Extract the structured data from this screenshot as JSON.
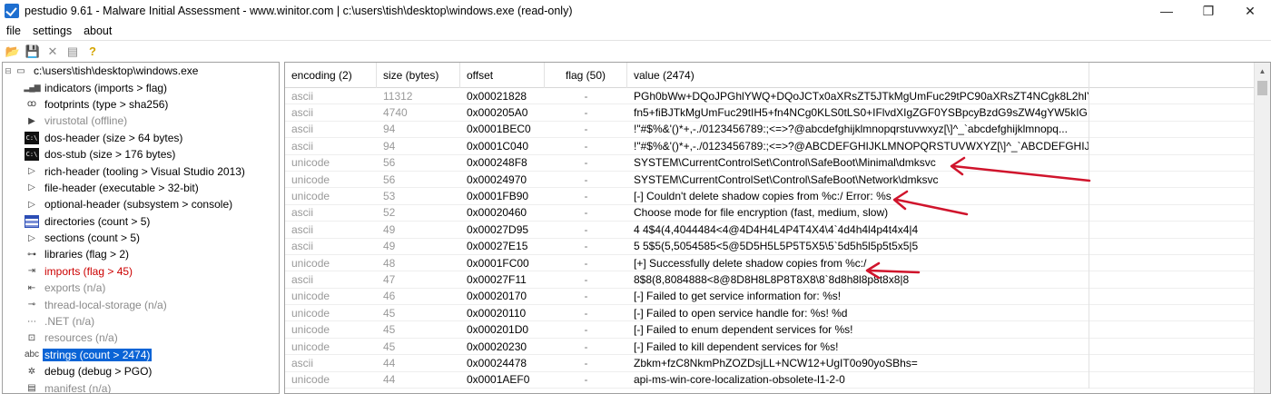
{
  "window": {
    "title": "pestudio 9.61 - Malware Initial Assessment - www.winitor.com | c:\\users\\tish\\desktop\\windows.exe (read-only)",
    "controls": {
      "minimize": "—",
      "maximize": "❐",
      "close": "✕"
    }
  },
  "menu": [
    "file",
    "settings",
    "about"
  ],
  "toolbar": {
    "icons": [
      "open-icon",
      "save-icon",
      "close-file-icon",
      "copy-icon",
      "help-icon"
    ],
    "glyphs": [
      "📂",
      "💾",
      "✕",
      "▤",
      "?"
    ]
  },
  "tree": {
    "root": "c:\\users\\tish\\desktop\\windows.exe",
    "items": [
      {
        "label": "indicators (imports > flag)",
        "state": "normal",
        "icon": "bars"
      },
      {
        "label": "footprints (type > sha256)",
        "state": "normal",
        "icon": "footprints"
      },
      {
        "label": "virustotal (offline)",
        "state": "disabled",
        "icon": "play"
      },
      {
        "label": "dos-header (size > 64 bytes)",
        "state": "normal",
        "icon": "dos"
      },
      {
        "label": "dos-stub (size > 176 bytes)",
        "state": "normal",
        "icon": "dos"
      },
      {
        "label": "rich-header (tooling > Visual Studio 2013)",
        "state": "normal",
        "icon": "arrow"
      },
      {
        "label": "file-header (executable > 32-bit)",
        "state": "normal",
        "icon": "arrow"
      },
      {
        "label": "optional-header (subsystem > console)",
        "state": "normal",
        "icon": "arrow"
      },
      {
        "label": "directories (count > 5)",
        "state": "normal",
        "icon": "grid"
      },
      {
        "label": "sections (count > 5)",
        "state": "normal",
        "icon": "arrow"
      },
      {
        "label": "libraries (flag > 2)",
        "state": "normal",
        "icon": "link"
      },
      {
        "label": "imports (flag > 45)",
        "state": "red",
        "icon": "import"
      },
      {
        "label": "exports (n/a)",
        "state": "disabled",
        "icon": "export"
      },
      {
        "label": "thread-local-storage (n/a)",
        "state": "disabled",
        "icon": "thread"
      },
      {
        "label": ".NET (n/a)",
        "state": "disabled",
        "icon": "net"
      },
      {
        "label": "resources (n/a)",
        "state": "disabled",
        "icon": "resource"
      },
      {
        "label": "strings (count > 2474)",
        "state": "selected",
        "icon": "abc"
      },
      {
        "label": "debug (debug > PGO)",
        "state": "normal",
        "icon": "bug"
      },
      {
        "label": "manifest (n/a)",
        "state": "disabled",
        "icon": "manifest"
      }
    ]
  },
  "table": {
    "headers": [
      "encoding (2)",
      "size (bytes)",
      "offset",
      "flag (50)",
      "value (2474)"
    ],
    "rows": [
      [
        "ascii",
        "11312",
        "0x00021828",
        "-",
        "PGh0bWw+DQoJPGhlYWQ+DQoJCTx0aXRsZT5JTkMgUmFuc29tPC90aXRsZT4NCgk8L2hlY..."
      ],
      [
        "ascii",
        "4740",
        "0x000205A0",
        "-",
        "fn5+fiBJTkMgUmFuc29tIH5+fn4NCg0KLS0tLS0+IFlvdXIgZGF0YSBpcyBzdG9sZW4gYW5kIG..."
      ],
      [
        "ascii",
        "94",
        "0x0001BEC0",
        "-",
        "!\"#$%&'()*+,-./0123456789:;<=>?@abcdefghijklmnopqrstuvwxyz[\\]^_`abcdefghijklmnopq..."
      ],
      [
        "ascii",
        "94",
        "0x0001C040",
        "-",
        "!\"#$%&'()*+,-./0123456789:;<=>?@ABCDEFGHIJKLMNOPQRSTUVWXYZ[\\]^_`ABCDEFGHIJ..."
      ],
      [
        "unicode",
        "56",
        "0x000248F8",
        "-",
        "SYSTEM\\CurrentControlSet\\Control\\SafeBoot\\Minimal\\dmksvc"
      ],
      [
        "unicode",
        "56",
        "0x00024970",
        "-",
        "SYSTEM\\CurrentControlSet\\Control\\SafeBoot\\Network\\dmksvc"
      ],
      [
        "unicode",
        "53",
        "0x0001FB90",
        "-",
        "[-] Couldn't delete shadow copies from %c:/ Error: %s"
      ],
      [
        "ascii",
        "52",
        "0x00020460",
        "-",
        "Choose mode for file encryption (fast, medium, slow)"
      ],
      [
        "ascii",
        "49",
        "0x00027D95",
        "-",
        "4 4$4(4,4044484<4@4D4H4L4P4T4X4\\4`4d4h4l4p4t4x4|4"
      ],
      [
        "ascii",
        "49",
        "0x00027E15",
        "-",
        "5 5$5(5,5054585<5@5D5H5L5P5T5X5\\5`5d5h5l5p5t5x5|5"
      ],
      [
        "unicode",
        "48",
        "0x0001FC00",
        "-",
        "[+] Successfully delete shadow copies from %c:/"
      ],
      [
        "ascii",
        "47",
        "0x00027F11",
        "-",
        "8$8(8,8084888<8@8D8H8L8P8T8X8\\8`8d8h8l8p8t8x8|8"
      ],
      [
        "unicode",
        "46",
        "0x00020170",
        "-",
        "[-] Failed to get service information for: %s!"
      ],
      [
        "unicode",
        "45",
        "0x00020110",
        "-",
        "[-] Failed to open service handle for: %s! %d"
      ],
      [
        "unicode",
        "45",
        "0x000201D0",
        "-",
        "[-] Failed to enum dependent services for %s!"
      ],
      [
        "unicode",
        "45",
        "0x00020230",
        "-",
        "[-] Failed to kill dependent services for %s!"
      ],
      [
        "ascii",
        "44",
        "0x00024478",
        "-",
        "Zbkm+fzC8NkmPhZOZDsjLL+NCW12+UgIT0o90yoSBhs="
      ],
      [
        "unicode",
        "44",
        "0x0001AEF0",
        "-",
        "api-ms-win-core-localization-obsolete-l1-2-0"
      ]
    ]
  },
  "colors": {
    "selection": "#0a64d6",
    "annotation_arrow": "#d0142c",
    "flagged_text": "#cc0000"
  }
}
